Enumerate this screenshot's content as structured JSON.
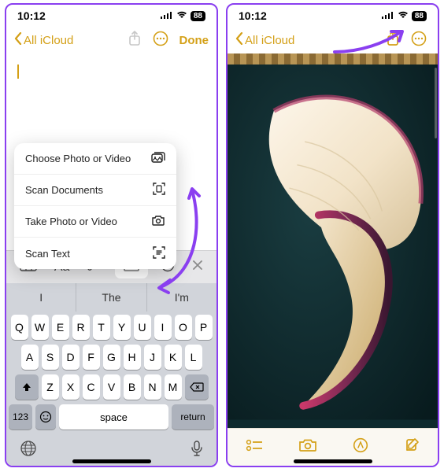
{
  "status": {
    "time": "10:12",
    "battery": "88"
  },
  "nav": {
    "back_label": "All iCloud",
    "done_label": "Done"
  },
  "popup": {
    "items": [
      {
        "label": "Choose Photo or Video",
        "icon": "photo-stack-icon"
      },
      {
        "label": "Scan Documents",
        "icon": "doc-scan-icon"
      },
      {
        "label": "Take Photo or Video",
        "icon": "camera-icon"
      },
      {
        "label": "Scan Text",
        "icon": "text-scan-icon"
      }
    ]
  },
  "suggestions": [
    "I",
    "The",
    "I'm"
  ],
  "keyboard": {
    "row1": [
      "Q",
      "W",
      "E",
      "R",
      "T",
      "Y",
      "U",
      "I",
      "O",
      "P"
    ],
    "row2": [
      "A",
      "S",
      "D",
      "F",
      "G",
      "H",
      "J",
      "K",
      "L"
    ],
    "row3": [
      "Z",
      "X",
      "C",
      "V",
      "B",
      "N",
      "M"
    ],
    "space_label": "space",
    "return_label": "return",
    "numbers_label": "123"
  },
  "colors": {
    "accent": "#d4a017",
    "annotate": "#8a3ff0"
  }
}
